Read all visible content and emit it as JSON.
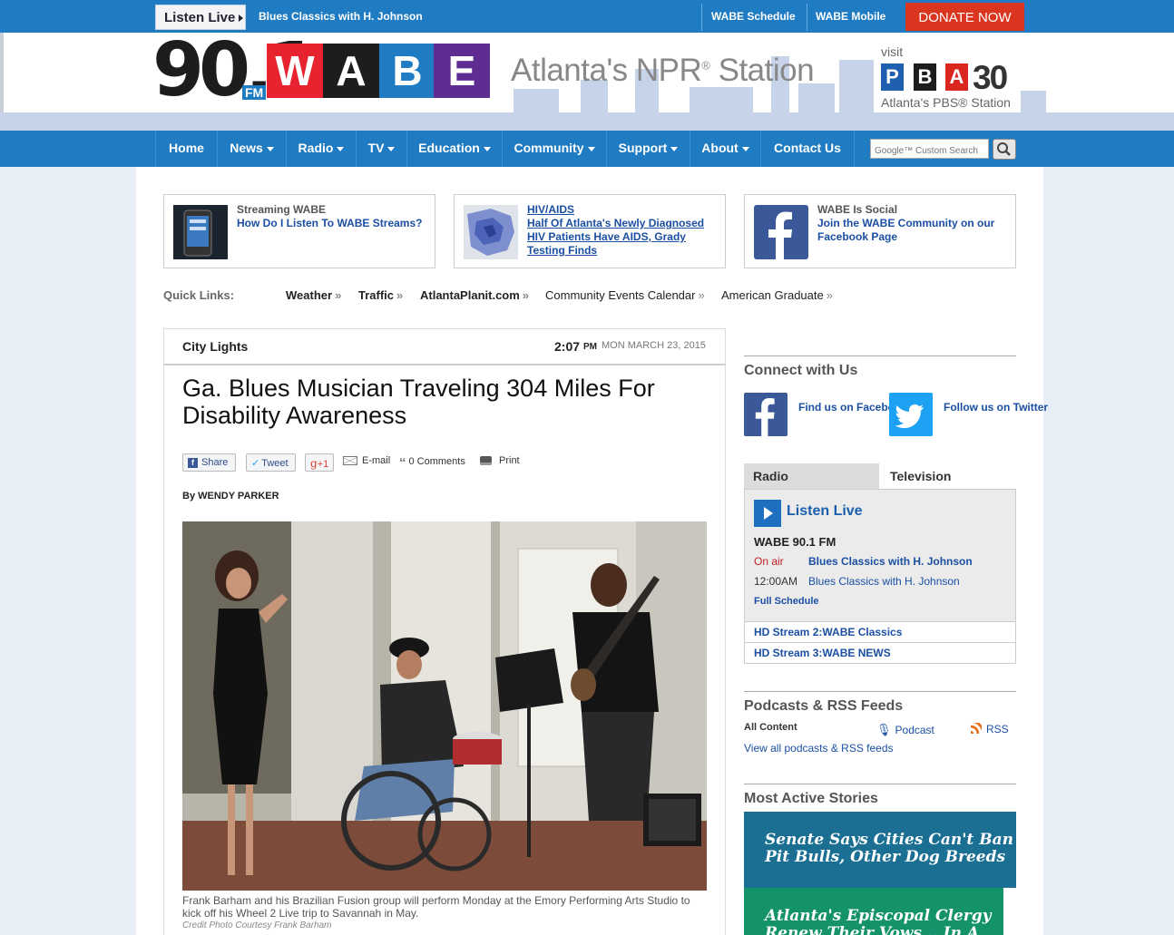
{
  "topbar": {
    "listen_live": "Listen Live",
    "now_playing": "Blues Classics with H. Johnson",
    "schedule_link": "WABE Schedule",
    "mobile_link": "WABE Mobile",
    "donate": "DONATE NOW"
  },
  "header": {
    "logo_number": "90.1",
    "logo_fm": "FM",
    "logo_letters": [
      "W",
      "A",
      "B",
      "E"
    ],
    "logo_colors": [
      "#e6232e",
      "#1d1d1d",
      "#1f7bc2",
      "#5f2d91"
    ],
    "tagline": "Atlanta's NPR",
    "tagline_reg": "®",
    "tagline_tail": " Station",
    "visit": "visit",
    "pba_letters": [
      "P",
      "B",
      "A"
    ],
    "pba_colors": [
      "#1f5fb0",
      "#1d1d1d",
      "#d9261f"
    ],
    "pba_number": "30",
    "pbs_line": "Atlanta's PBS® Station"
  },
  "nav": {
    "items": [
      {
        "label": "Home",
        "dropdown": false
      },
      {
        "label": "News",
        "dropdown": true
      },
      {
        "label": "Radio",
        "dropdown": true
      },
      {
        "label": "TV",
        "dropdown": true
      },
      {
        "label": "Education",
        "dropdown": true
      },
      {
        "label": "Community",
        "dropdown": true
      },
      {
        "label": "Support",
        "dropdown": true
      },
      {
        "label": "About",
        "dropdown": true
      },
      {
        "label": "Contact Us",
        "dropdown": false
      }
    ],
    "search_placeholder": "Google™ Custom Search"
  },
  "promos": [
    {
      "category": "Streaming WABE",
      "title": "How Do I Listen To WABE Streams?",
      "underlined": false
    },
    {
      "category": "HIV/AIDS",
      "title": "Half Of Atlanta's Newly Diagnosed HIV Patients Have AIDS, Grady Testing Finds",
      "underlined": true
    },
    {
      "category": "WABE Is Social",
      "title": "Join the WABE Community on our Facebook Page",
      "underlined": false
    }
  ],
  "quicklinks": {
    "label": "Quick Links:",
    "items": [
      "Weather",
      "Traffic",
      "AtlantaPlanit.com",
      "Community Events Calendar",
      "American Graduate"
    ],
    "raquo": "»"
  },
  "article": {
    "section": "City Lights",
    "time": "2:07",
    "ampm": "PM",
    "date": "MON MARCH 23, 2015",
    "headline": "Ga. Blues Musician Traveling 304 Miles For Disability Awareness",
    "share": "Share",
    "tweet": "Tweet",
    "gplus": "+1",
    "email": "E-mail",
    "comments": "0 Comments",
    "print": "Print",
    "byline": "By WENDY PARKER",
    "caption": "Frank Barham and his Brazilian Fusion group will perform Monday at the Emory Performing Arts Studio to kick off his Wheel 2 Live trip to Savannah in May.",
    "credit": "Credit Photo Courtesy Frank Barham",
    "photo_amp_label": "guitar"
  },
  "sidebar": {
    "connect_title": "Connect with Us",
    "facebook_text": "Find us on Facebook",
    "twitter_text": "Follow us on Twitter",
    "tab_radio": "Radio",
    "tab_tv": "Television",
    "listen_live": "Listen Live",
    "station": "WABE 90.1 FM",
    "on_air_label": "On air",
    "on_air_show": "Blues Classics with H. Johnson",
    "next_time": "12:00AM",
    "next_show": "Blues Classics with H. Johnson",
    "full_schedule": "Full Schedule",
    "hd2": "HD Stream 2:WABE Classics",
    "hd3": "HD Stream 3:WABE NEWS",
    "podcasts_title": "Podcasts & RSS Feeds",
    "all_content": "All Content",
    "podcast": "Podcast",
    "rss": "RSS",
    "view_all": "View all podcasts & RSS feeds",
    "most_active_title": "Most Active Stories",
    "stories": [
      {
        "title": "Senate Says Cities Can't Ban Pit Bulls, Other Dog Breeds",
        "color": "#1a6f93"
      },
      {
        "title": "Atlanta's Episcopal Clergy Renew Their Vows... In A",
        "color": "#14936b"
      }
    ]
  },
  "colors": {
    "brand_blue": "#1f7bc2",
    "donate_red": "#d9351f",
    "link_blue": "#1a4fa3",
    "facebook": "#3b5998",
    "twitter": "#1da1f2"
  }
}
